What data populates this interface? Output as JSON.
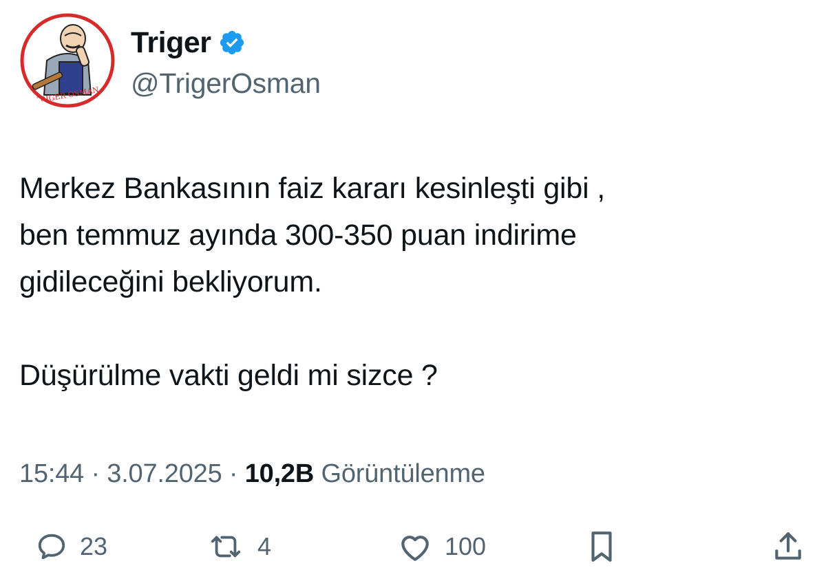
{
  "user": {
    "display_name": "Triger",
    "handle": "@TrigerOsman",
    "verified": true,
    "avatar_badge_text": "TRIGER OSMAN"
  },
  "tweet": {
    "paragraph1": "Merkez Bankasının faiz kararı kesinleşti gibi ,\nben temmuz ayında 300-350 puan indirime\ngidileceğini bekliyorum.",
    "paragraph2": "Düşürülme vakti geldi mi sizce ?"
  },
  "meta": {
    "time": "15:44",
    "separator": " · ",
    "date": "3.07.2025",
    "views_count": "10,2B",
    "views_label": " Görüntülenme"
  },
  "actions": {
    "replies": "23",
    "retweets": "4",
    "likes": "100"
  },
  "colors": {
    "text_primary": "#0f1419",
    "text_secondary": "#536471",
    "verified_blue": "#1d9bf0",
    "avatar_ring_red": "#d62b2b"
  },
  "icons": {
    "verified": "verified-badge-icon",
    "reply": "speech-bubble-icon",
    "retweet": "retweet-arrows-icon",
    "like": "heart-icon",
    "bookmark": "bookmark-icon",
    "share": "share-upload-icon"
  }
}
